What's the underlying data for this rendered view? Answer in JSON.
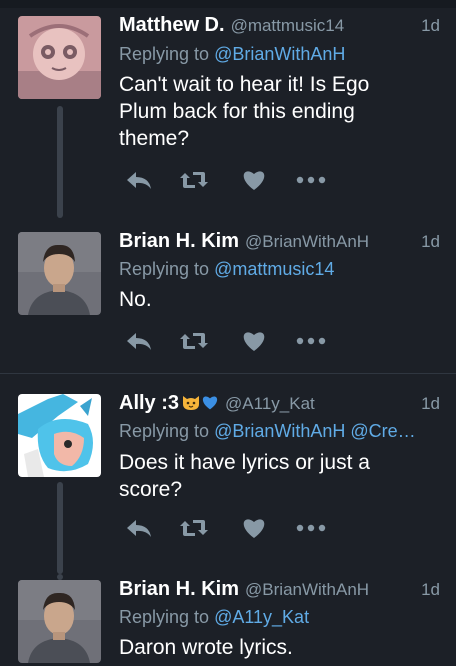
{
  "tweets": [
    {
      "name": "Matthew D.",
      "handle": "@mattmusic14",
      "time": "1d",
      "replying_prefix": "Replying to",
      "replying_to": "@BrianWithAnH",
      "replying_to_2": "",
      "text": "Can't wait to hear it! Is Ego Plum back for this ending theme?"
    },
    {
      "name": "Brian H. Kim",
      "handle": "@BrianWithAnH",
      "time": "1d",
      "replying_prefix": "Replying to",
      "replying_to": "@mattmusic14",
      "replying_to_2": "",
      "text": "No."
    },
    {
      "name": "Ally :3",
      "name_emojis": [
        "cat-face-emoji",
        "blue-heart-emoji"
      ],
      "handle": "@A11y_Kat",
      "time": "1d",
      "replying_prefix": "Replying to",
      "replying_to": "@BrianWithAnH",
      "replying_to_2": "@Cre…",
      "text": "Does it have lyrics or just a score?"
    },
    {
      "name": "Brian H. Kim",
      "handle": "@BrianWithAnH",
      "time": "1d",
      "replying_prefix": "Replying to",
      "replying_to": "@A11y_Kat",
      "replying_to_2": "",
      "text": "Daron wrote lyrics."
    }
  ],
  "action_icons": [
    "reply-icon",
    "retweet-icon",
    "like-icon",
    "more-icon"
  ],
  "colors": {
    "background": "#1c2027",
    "muted_text": "#8899a6",
    "mention": "#60abe6",
    "icon": "#8899a6",
    "thread_line": "#3b424c"
  }
}
